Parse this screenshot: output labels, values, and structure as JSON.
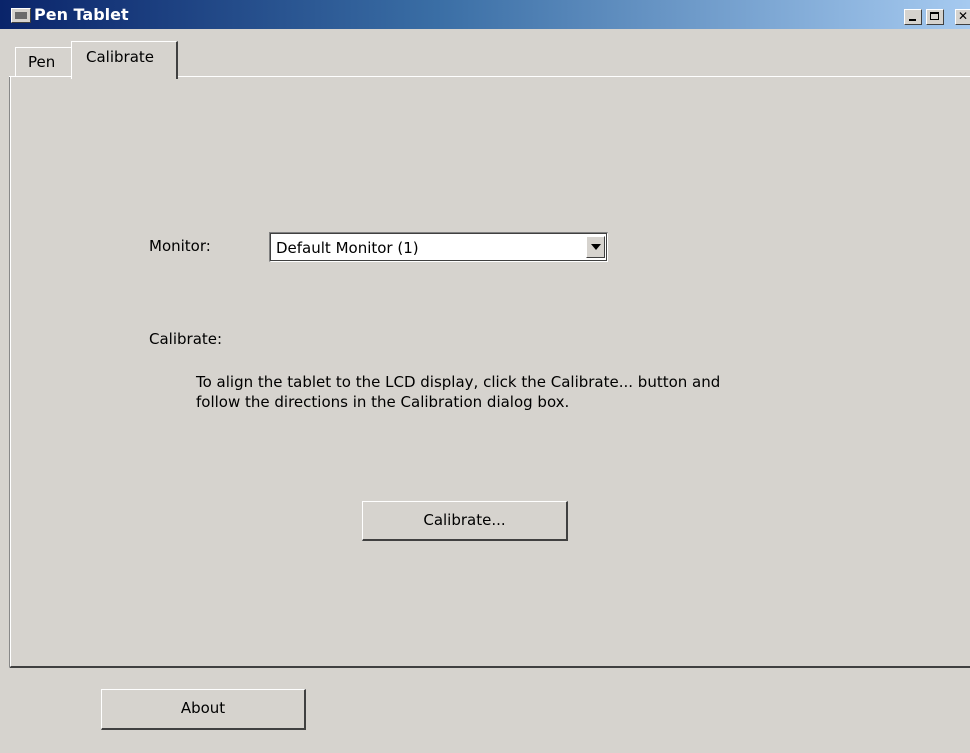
{
  "window": {
    "title": "Pen Tablet",
    "controls": [
      "minimize",
      "maximize",
      "close"
    ]
  },
  "tabs": [
    {
      "label": "Pen",
      "selected": false
    },
    {
      "label": "Calibrate",
      "selected": true
    }
  ],
  "calibrate_page": {
    "monitor_label": "Monitor:",
    "monitor_select": {
      "value": "Default Monitor (1)"
    },
    "calibrate_label": "Calibrate:",
    "description_line1": "To align the tablet to the LCD display, click the Calibrate... button and",
    "description_line2": "follow the directions in the Calibration dialog box.",
    "calibrate_button": "Calibrate..."
  },
  "footer": {
    "about_button": "About"
  },
  "icons": {
    "app": "tablet-app-icon",
    "dropdown": "dropdown-arrow-icon"
  }
}
